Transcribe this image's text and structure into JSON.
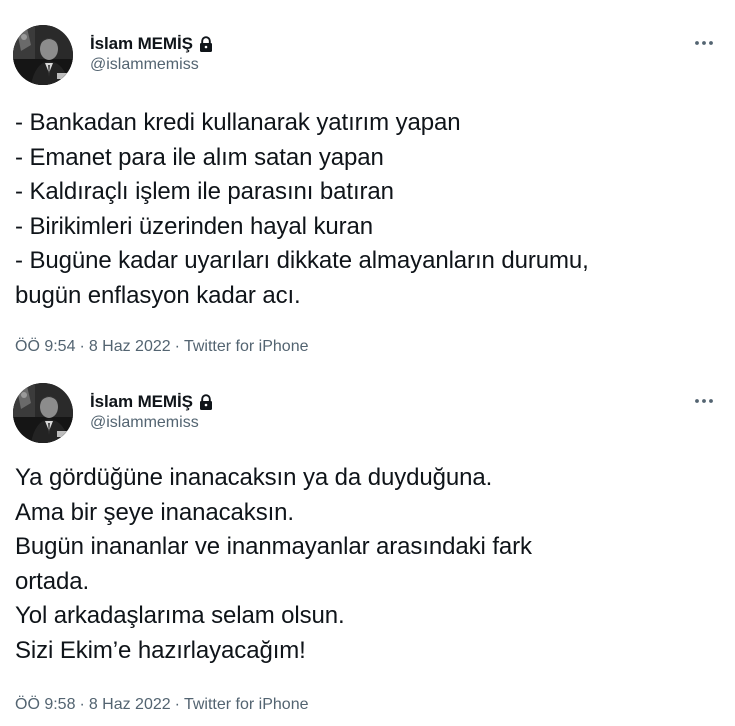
{
  "tweets": [
    {
      "author": {
        "display_name": "İslam MEMİŞ",
        "handle": "@islammemiss",
        "protected_icon": "lock-icon"
      },
      "more_icon": "more-horizontal-icon",
      "lines": [
        "- Bankadan kredi kullanarak yatırım yapan",
        "- Emanet para ile alım satan yapan",
        "- Kaldıraçlı işlem ile parasını batıran",
        "- Birikimleri üzerinden hayal kuran",
        "- Bugüne kadar uyarıları dikkate almayanların durumu,",
        "bugün enflasyon kadar acı."
      ],
      "time": "ÖÖ 9:54",
      "separator": "·",
      "date": "8 Haz 2022",
      "source": "Twitter for iPhone"
    },
    {
      "author": {
        "display_name": "İslam MEMİŞ",
        "handle": "@islammemiss",
        "protected_icon": "lock-icon"
      },
      "more_icon": "more-horizontal-icon",
      "lines": [
        "Ya gördüğüne inanacaksın ya da duyduğuna.",
        "Ama bir şeye inanacaksın.",
        "Bugün inananlar ve inanmayanlar arasındaki fark",
        "ortada.",
        "Yol arkadaşlarıma selam olsun.",
        "Sizi Ekim’e hazırlayacağım!"
      ],
      "time": "ÖÖ 9:58",
      "separator": "·",
      "date": "8 Haz 2022",
      "source": "Twitter for iPhone"
    }
  ],
  "colors": {
    "text": "#0f1419",
    "secondary_text": "#536471",
    "background": "#ffffff",
    "avatar_bg": "#1d1d1d"
  }
}
